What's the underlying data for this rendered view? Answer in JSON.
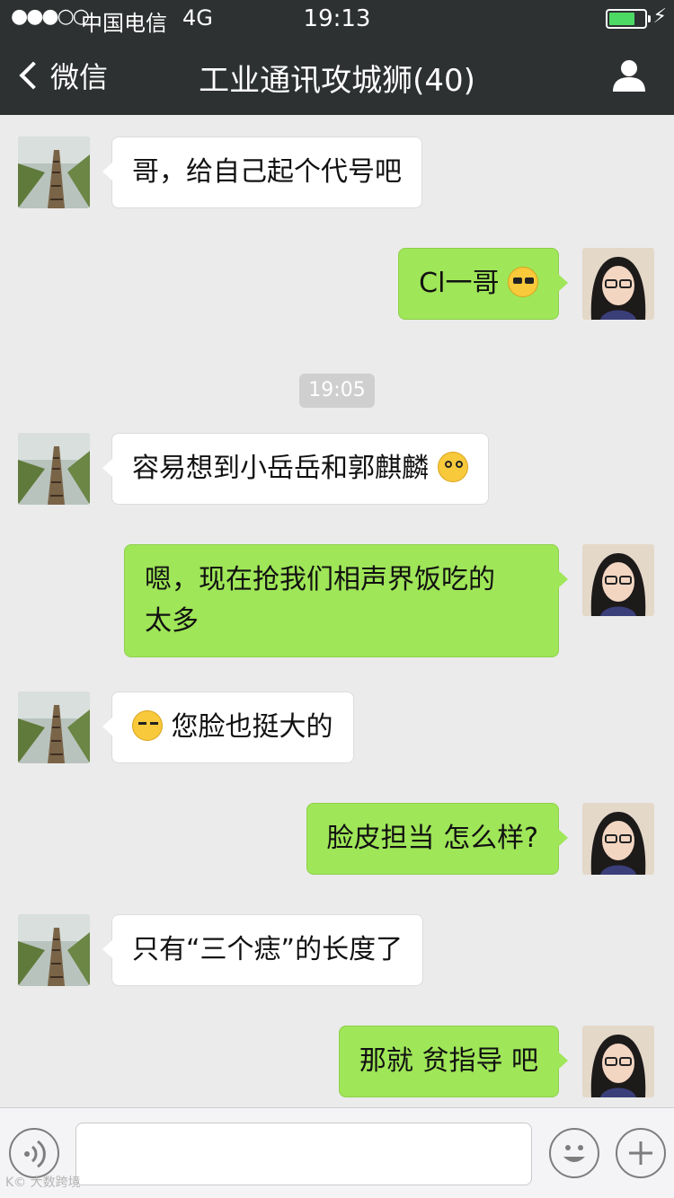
{
  "status_bar": {
    "signal": "●●●○○",
    "carrier": "中国电信",
    "network": "4G",
    "time": "19:13",
    "battery_level": 0.74
  },
  "nav": {
    "back_label": "微信",
    "title": "工业通讯攻城狮(40)"
  },
  "timestamp": "19:05",
  "messages": [
    {
      "side": "left",
      "text": "哥，给自己起个代号吧"
    },
    {
      "side": "right",
      "text": "Cl一哥",
      "emoji": "sunglasses-emoji"
    },
    {
      "side": "left",
      "text": "容易想到小岳岳和郭麒麟",
      "emoji": "dizzy-emoji"
    },
    {
      "side": "right",
      "line1": "嗯，现在抢我们相声界饭吃的",
      "line2": "太多"
    },
    {
      "side": "left",
      "text": "您脸也挺大的",
      "emoji": "sweat-emoji"
    },
    {
      "side": "right",
      "text": "脸皮担当 怎么样?"
    },
    {
      "side": "left",
      "text": "只有“三个痣”的长度了"
    },
    {
      "side": "right",
      "text": "那就 贫指导 吧"
    }
  ],
  "input_bar": {
    "placeholder": ""
  },
  "watermark": "K© 大数跨境",
  "colors": {
    "topbar": "#2e3132",
    "my_bubble": "#9fe658",
    "their_bubble": "#ffffff",
    "background": "#ebebeb"
  }
}
